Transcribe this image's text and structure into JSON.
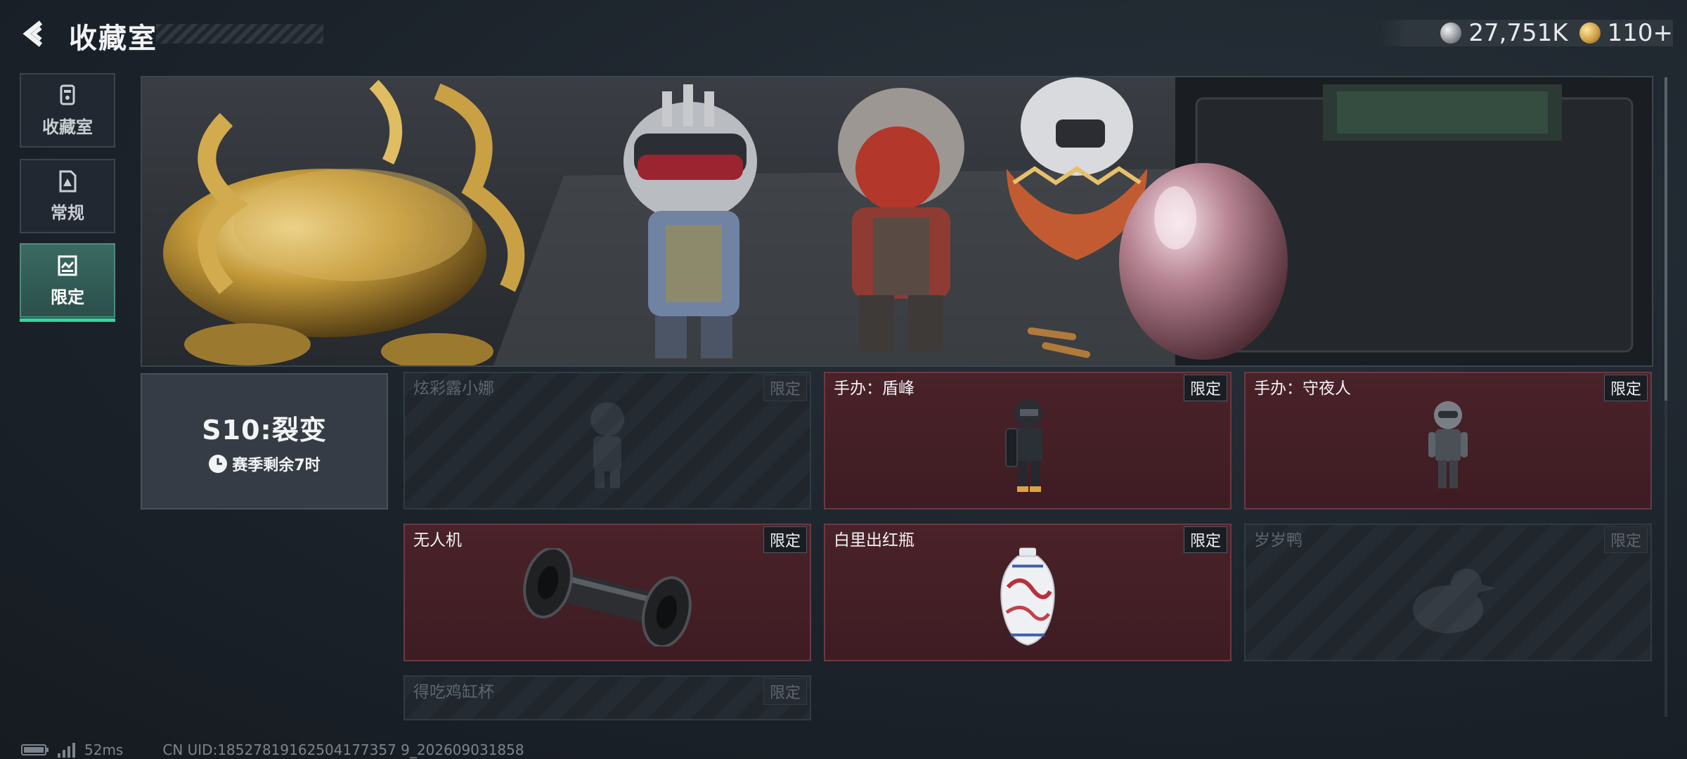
{
  "header": {
    "title": "收藏室",
    "back_icon": "back-arrow-icon",
    "currencies": [
      {
        "icon": "silver-coin-icon",
        "value": "27,751K"
      },
      {
        "icon": "gold-coin-icon",
        "value": "110+"
      }
    ]
  },
  "sidebar": {
    "items": [
      {
        "label": "收藏室",
        "icon": "collection-icon",
        "active": false
      },
      {
        "label": "常规",
        "icon": "regular-icon",
        "active": false
      },
      {
        "label": "限定",
        "icon": "limited-icon",
        "active": true
      }
    ]
  },
  "season": {
    "title": "S10:裂变",
    "remaining": "赛季剩余7时",
    "clock_icon": "clock-icon"
  },
  "items": [
    {
      "name": "炫彩露小娜",
      "tag": "限定",
      "state": "locked"
    },
    {
      "name": "手办：盾峰",
      "tag": "限定",
      "state": "owned"
    },
    {
      "name": "手办：守夜人",
      "tag": "限定",
      "state": "owned"
    },
    {
      "name": "无人机",
      "tag": "限定",
      "state": "owned"
    },
    {
      "name": "白里出红瓶",
      "tag": "限定",
      "state": "owned"
    },
    {
      "name": "岁岁鸭",
      "tag": "限定",
      "state": "locked"
    },
    {
      "name": "得吃鸡缸杯",
      "tag": "限定",
      "state": "locked"
    }
  ],
  "footer": {
    "ping": "52ms",
    "uid": "CN UID:18527819162504177357 9_202609031858"
  },
  "colors": {
    "accent": "#38d39b",
    "owned_card": "#4a2229",
    "background": "#1b2129"
  }
}
